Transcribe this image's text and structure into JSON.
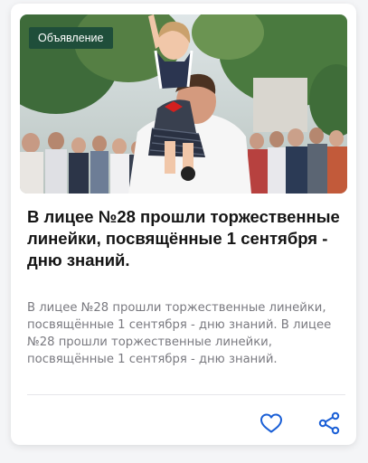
{
  "card": {
    "badge": "Объявление",
    "title": "В лицее №28 прошли торжественные линейки, посвящённые 1 сентября - дню знаний.",
    "description": "В лицее №28 прошли торжественные линейки, посвящённые 1 сентября - дню знаний. В лицее №28 прошли торжественные линейки, посвящённые 1 сентября - дню знаний.",
    "image": {
      "subject": "man-carrying-girl-in-school-uniform",
      "icon": "photo"
    }
  },
  "actions": {
    "like_icon": "heart-icon",
    "share_icon": "share-icon",
    "icon_color": "#1a5fd6"
  },
  "colors": {
    "badge_bg": "#1f4e3a",
    "title": "#151515",
    "description": "#7a7a80"
  }
}
